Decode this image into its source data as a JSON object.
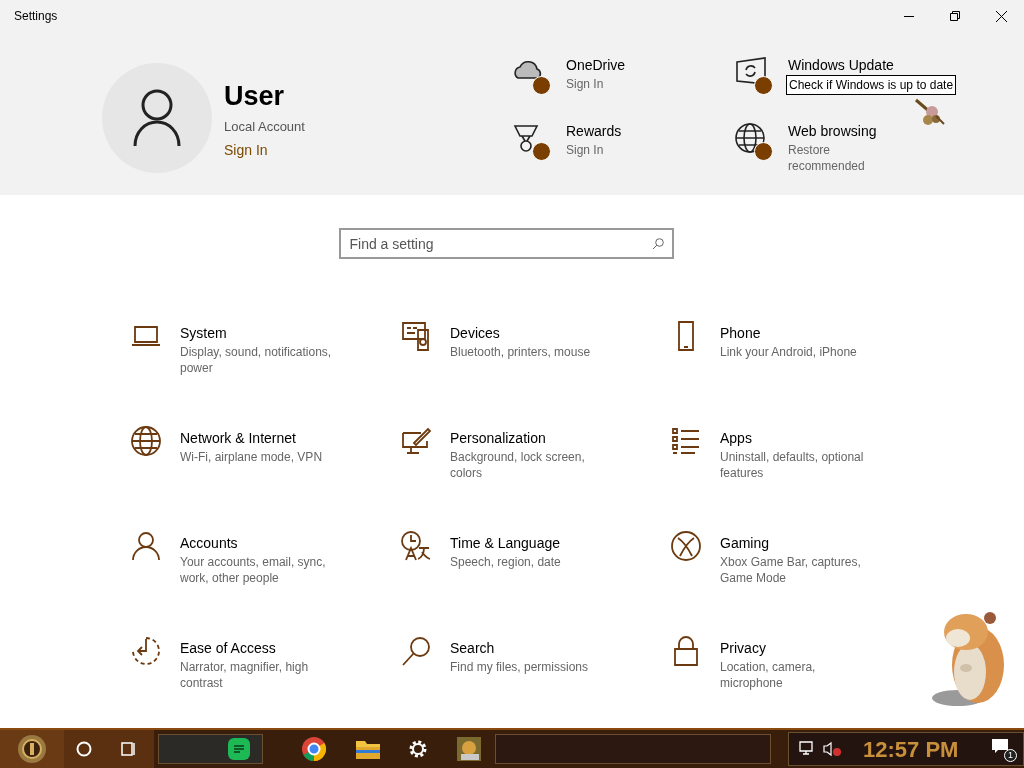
{
  "window": {
    "title": "Settings"
  },
  "account": {
    "name": "User",
    "type": "Local Account",
    "link": "Sign In"
  },
  "quick_links": [
    {
      "title": "OneDrive",
      "subtitle": "Sign In"
    },
    {
      "title": "Windows Update"
    },
    {
      "title": "Rewards",
      "subtitle": "Sign In"
    },
    {
      "title": "Web browsing",
      "subtitle": "Restore recommended"
    }
  ],
  "tooltip": "Check if Windows is up to date",
  "search": {
    "placeholder": "Find a setting"
  },
  "categories": [
    {
      "title": "System",
      "subtitle": "Display, sound, notifications, power"
    },
    {
      "title": "Devices",
      "subtitle": "Bluetooth, printers, mouse"
    },
    {
      "title": "Phone",
      "subtitle": "Link your Android, iPhone"
    },
    {
      "title": "Network & Internet",
      "subtitle": "Wi-Fi, airplane mode, VPN"
    },
    {
      "title": "Personalization",
      "subtitle": "Background, lock screen, colors"
    },
    {
      "title": "Apps",
      "subtitle": "Uninstall, defaults, optional features"
    },
    {
      "title": "Accounts",
      "subtitle": "Your accounts, email, sync, work, other people"
    },
    {
      "title": "Time & Language",
      "subtitle": "Speech, region, date"
    },
    {
      "title": "Gaming",
      "subtitle": "Xbox Game Bar, captures, Game Mode"
    },
    {
      "title": "Ease of Access",
      "subtitle": "Narrator, magnifier, high contrast"
    },
    {
      "title": "Search",
      "subtitle": "Find my files, permissions"
    },
    {
      "title": "Privacy",
      "subtitle": "Location, camera, microphone"
    }
  ],
  "taskbar": {
    "clock": "12:57 PM",
    "notification_count": "1"
  }
}
